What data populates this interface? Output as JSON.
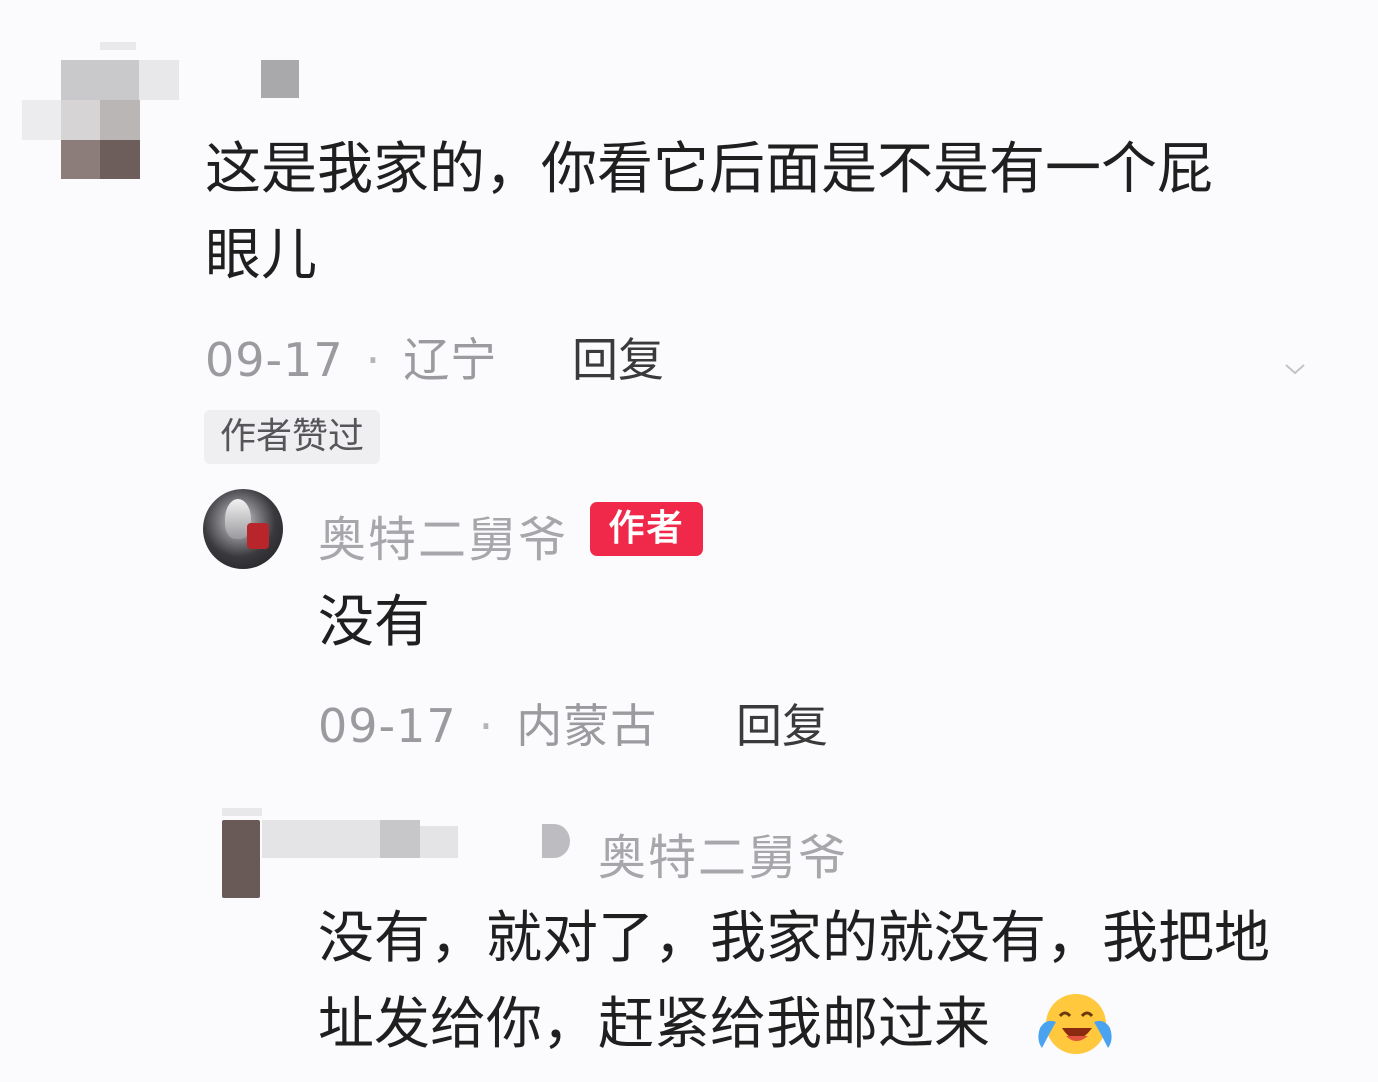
{
  "comment1": {
    "text_line1": "这是我家的，你看它后面是不是有一个屁",
    "text_line2": "眼儿",
    "date": "09-17",
    "location": "辽宁",
    "reply_label": "回复",
    "liked_badge": "作者赞过"
  },
  "reply1": {
    "username": "奥特二舅爷",
    "author_badge": "作者",
    "text": "没有",
    "date": "09-17",
    "location": "内蒙古",
    "reply_label": "回复"
  },
  "reply2": {
    "reply_to_name": "奥特二舅爷",
    "text_line1": "没有，就对了，我家的就没有，我把地",
    "text_line2": "址发给你，赶紧给我邮过来",
    "emoji": "laughing-crying-emoji"
  },
  "colors": {
    "author_badge_bg": "#f0284a",
    "meta_gray": "#9a9a9f"
  }
}
